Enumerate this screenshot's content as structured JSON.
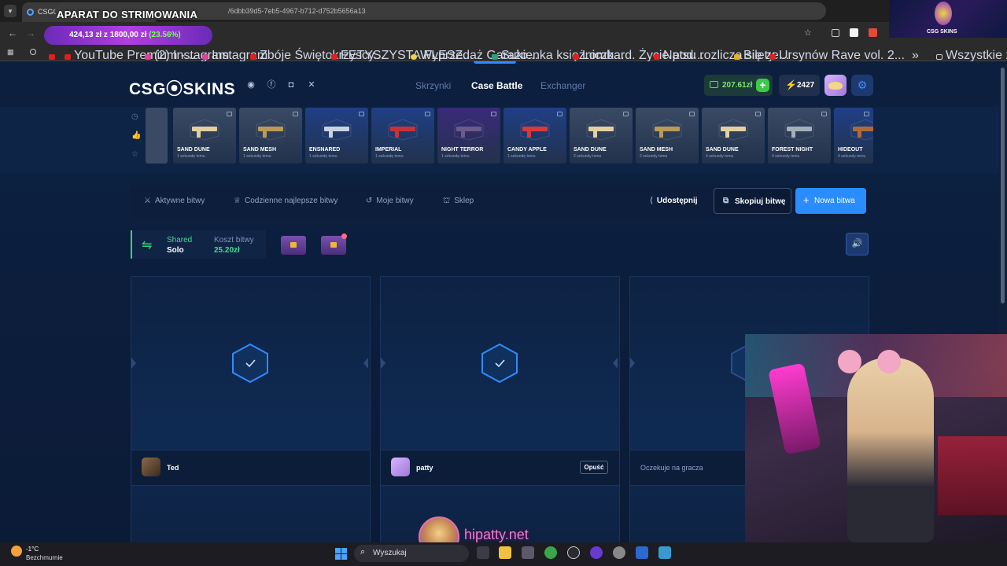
{
  "browser": {
    "tab_title": "CSGO-SKINS.COM - Najlepsze...",
    "url": "/6dbb39d5-7eb5-4967-b712-d752b5656a13",
    "bookmarks": [
      "YouTube Premium -...",
      "(2) Instagram",
      "Instagram",
      "Zbóje Świętokrzyscy...",
      "FETYSZYSTA FLESZ...",
      "Wyprzedaż Garażo...",
      "Sukienka księżniczk...",
      "Lombard. Życie pod...",
      "Natsu rozlicza się ze...",
      "Bilety",
      "Ursynów Rave vol. 2...",
      "Wszystkie zakładki"
    ]
  },
  "overlay": {
    "title": "APARAT DO STRIMOWANIA",
    "goal": "424,13 zł z 1800,00 zł",
    "goal_pct": "(23.56%)",
    "corner_label": "CSG SKINS",
    "channel": "hipatty.net"
  },
  "site": {
    "logo": "CSG⦿SKINS",
    "nav": [
      "Skrzynki",
      "Case Battle",
      "Exchanger"
    ],
    "balance": "207.61zł",
    "points": "2427"
  },
  "drops": [
    {
      "name": "SAND DUNE",
      "time": "1 sekundę temu",
      "color": "#3a4a64",
      "gun": "#e3cfa0"
    },
    {
      "name": "SAND MESH",
      "time": "1 sekundę temu",
      "color": "#3a4a64",
      "gun": "#b99b57"
    },
    {
      "name": "ENSNARED",
      "time": "1 sekundę temu",
      "color": "#1f3f86",
      "gun": "#c9d3e0"
    },
    {
      "name": "IMPERIAL",
      "time": "1 sekundę temu",
      "color": "#1f3f86",
      "gun": "#c93236"
    },
    {
      "name": "NIGHT TERROR",
      "time": "1 sekundę temu",
      "color": "#3a2a7a",
      "gun": "#6b5a8a"
    },
    {
      "name": "CANDY APPLE",
      "time": "1 sekundę temu",
      "color": "#1f3f86",
      "gun": "#d63a3a"
    },
    {
      "name": "SAND DUNE",
      "time": "2 sekundy temu",
      "color": "#3a4a64",
      "gun": "#e3cfa0"
    },
    {
      "name": "SAND MESH",
      "time": "2 sekundy temu",
      "color": "#3a4a64",
      "gun": "#b99b57"
    },
    {
      "name": "SAND DUNE",
      "time": "4 sekundy temu",
      "color": "#3a4a64",
      "gun": "#e3cfa0"
    },
    {
      "name": "FOREST NIGHT",
      "time": "4 sekundy temu",
      "color": "#3a4a64",
      "gun": "#a4b0b8"
    },
    {
      "name": "HIDEOUT",
      "time": "4 sekundy temu",
      "color": "#1f3f86",
      "gun": "#b06a3a"
    }
  ],
  "battle_nav": {
    "tabs": [
      "Aktywne bitwy",
      "Codzienne najlepsze bitwy",
      "Moje bitwy",
      "Sklep"
    ],
    "share": "Udostępnij",
    "copy": "Skopiuj bitwę",
    "new": "Nowa bitwa"
  },
  "battle": {
    "mode": "Shared",
    "mode2": "Solo",
    "cost_label": "Koszt bitwy",
    "cost": "25.20zł"
  },
  "players": [
    {
      "name": "Ted",
      "status": "joined"
    },
    {
      "name": "patty",
      "status": "joined",
      "action": "Opuść"
    },
    {
      "name": "",
      "status": "Oczekuje na gracza"
    }
  ],
  "taskbar": {
    "temp": "-1°C",
    "condition": "Bezchmurnie",
    "search": "Wyszukaj"
  }
}
